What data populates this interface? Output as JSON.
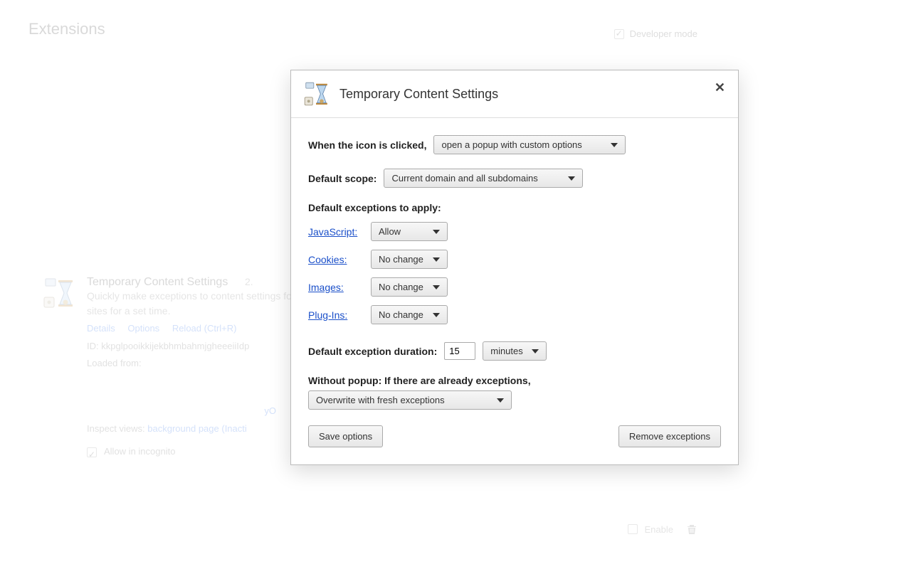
{
  "page": {
    "title": "Extensions",
    "developer_mode_label": "Developer mode",
    "developer_mode_checked": true
  },
  "extension": {
    "name": "Temporary Content Settings",
    "version": "2.",
    "description": "Quickly make exceptions to content settings for some or all sites for a set time.",
    "links": {
      "details": "Details",
      "options": "Options",
      "reload": "Reload (Ctrl+R)"
    },
    "id_label": "ID:",
    "id_value": "kkpglpooikkijekbhmbahmjgheeeiiIdp",
    "loaded_from_label": "Loaded from:",
    "inspect_label": "Inspect views:",
    "inspect_value": "background page (Inacti",
    "allow_incognito_label": "Allow in incognito",
    "enable_label": "Enable"
  },
  "dialog": {
    "title": "Temporary Content Settings",
    "when_clicked_label": "When the icon is clicked,",
    "when_clicked_value": "open a popup with custom options",
    "default_scope_label": "Default scope:",
    "default_scope_value": "Current domain and all subdomains",
    "exceptions_header": "Default exceptions to apply:",
    "exceptions": {
      "javascript": {
        "label": "JavaScript:",
        "value": "Allow"
      },
      "cookies": {
        "label": "Cookies:",
        "value": "No change"
      },
      "images": {
        "label": "Images:",
        "value": "No change"
      },
      "plugins": {
        "label": "Plug-Ins:",
        "value": "No change"
      }
    },
    "duration_label": "Default exception duration:",
    "duration_value": "15",
    "duration_unit": "minutes",
    "without_popup_label": "Without popup: If there are already exceptions,",
    "without_popup_value": "Overwrite with fresh exceptions",
    "save_label": "Save options",
    "remove_label": "Remove exceptions"
  }
}
